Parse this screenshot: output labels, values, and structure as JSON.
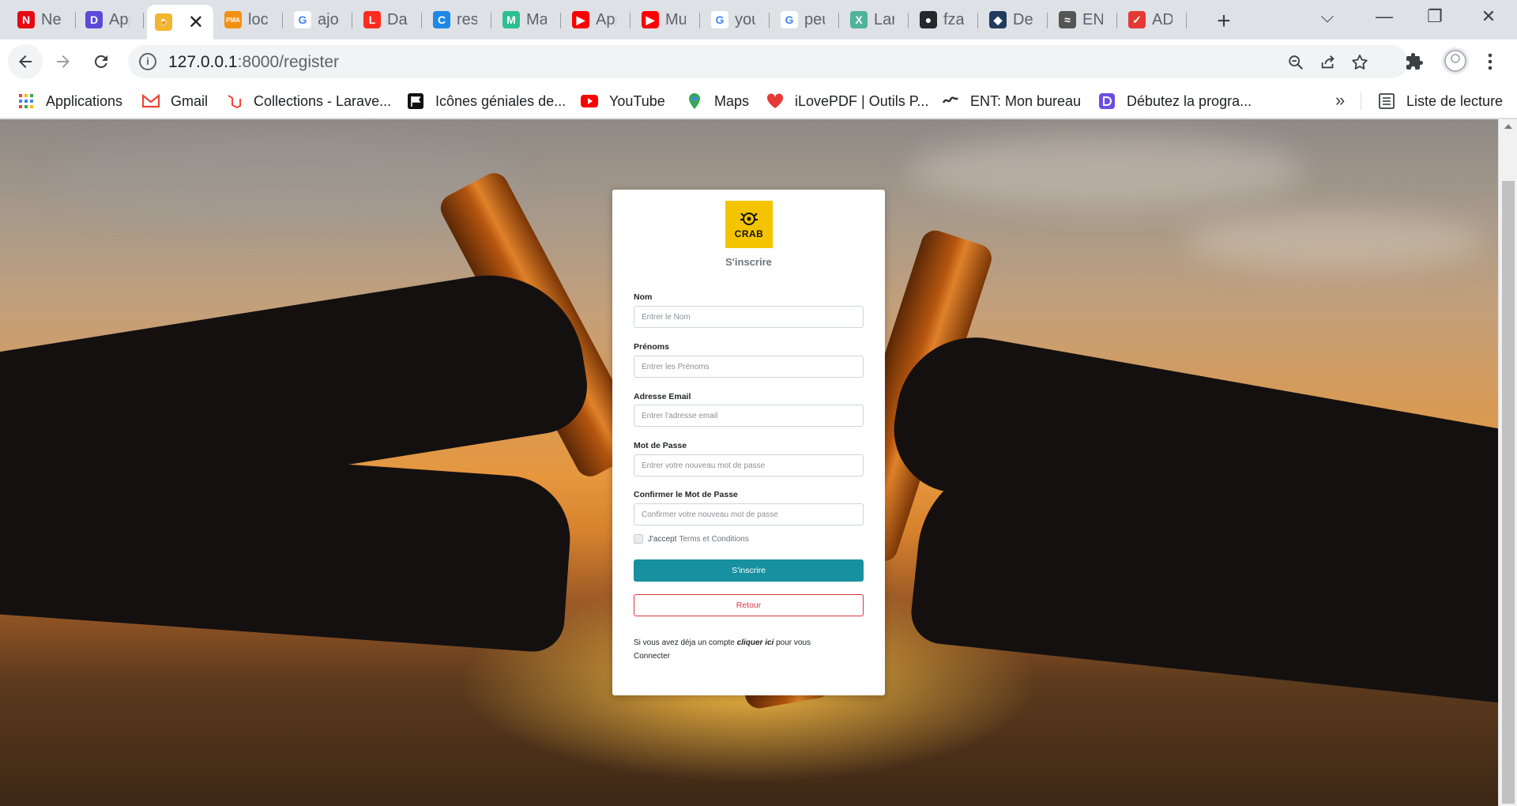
{
  "browser": {
    "tabs": [
      {
        "label": "Netflix",
        "icon": "netflix-icon",
        "color": "#e50914",
        "glyph": "N"
      },
      {
        "label": "Applications",
        "icon": "d-app-icon",
        "color": "#5b4ad9",
        "glyph": "D"
      },
      {
        "label": "",
        "icon": "beer-icon",
        "active": true,
        "color": "#f3b633",
        "glyph": "🍺"
      },
      {
        "label": "localhost",
        "icon": "phpmyadmin-icon",
        "color": "#f29111",
        "glyph": "PMA"
      },
      {
        "label": "ajouter",
        "icon": "google-icon",
        "color": "#ffffff",
        "glyph": "G"
      },
      {
        "label": "Database",
        "icon": "laravel-icon",
        "color": "#ff2d20",
        "glyph": "L"
      },
      {
        "label": "resources",
        "icon": "c-icon",
        "color": "#1e88e5",
        "glyph": "C"
      },
      {
        "label": "Material",
        "icon": "m-icon",
        "color": "#2ebf91",
        "glyph": "M"
      },
      {
        "label": "App",
        "icon": "youtube-icon",
        "color": "#ff0000",
        "glyph": "▶"
      },
      {
        "label": "Music",
        "icon": "youtube-icon",
        "color": "#ff0000",
        "glyph": "▶"
      },
      {
        "label": "youtube",
        "icon": "google-icon",
        "color": "#ffffff",
        "glyph": "G"
      },
      {
        "label": "peut",
        "icon": "google-icon",
        "color": "#ffffff",
        "glyph": "G"
      },
      {
        "label": "Laravel",
        "icon": "laravel-icon",
        "color": "#4fb39a",
        "glyph": "X"
      },
      {
        "label": "fzar",
        "icon": "github-icon",
        "color": "#24292e",
        "glyph": "●"
      },
      {
        "label": "Deezer",
        "icon": "deezer-icon",
        "color": "#233b5d",
        "glyph": "◆"
      },
      {
        "label": "ENT",
        "icon": "ent-icon",
        "color": "#555555",
        "glyph": "≈"
      },
      {
        "label": "ADE",
        "icon": "ade-icon",
        "color": "#e53935",
        "glyph": "✓"
      }
    ],
    "new_tab": "+",
    "address": {
      "host": "127.0.0.1",
      "path": ":8000/register",
      "info_glyph": "i"
    },
    "bookmarks": [
      {
        "label": "Applications",
        "icon": "apps-grid-icon"
      },
      {
        "label": "Gmail",
        "icon": "gmail-icon"
      },
      {
        "label": "Collections - Larave...",
        "icon": "laravel-icon"
      },
      {
        "label": "Icônes géniales de...",
        "icon": "fontawesome-flag-icon"
      },
      {
        "label": "YouTube",
        "icon": "youtube-icon"
      },
      {
        "label": "Maps",
        "icon": "maps-pin-icon"
      },
      {
        "label": "iLovePDF | Outils P...",
        "icon": "ilovepdf-heart-icon"
      },
      {
        "label": "ENT: Mon bureau",
        "icon": "ent-icon"
      },
      {
        "label": "Débutez la progra...",
        "icon": "d-app-icon"
      }
    ],
    "overflow": "»",
    "reading_list": "Liste de lecture"
  },
  "register": {
    "logo_text": "CRAB",
    "title": "S'inscrire",
    "fields": {
      "nom": {
        "label": "Nom",
        "placeholder": "Entrer le Nom"
      },
      "prenoms": {
        "label": "Prénoms",
        "placeholder": "Entrer les Prénoms"
      },
      "email": {
        "label": "Adresse Email",
        "placeholder": "Entrer l'adresse email"
      },
      "password": {
        "label": "Mot de Passe",
        "placeholder": "Entrer votre nouveau mot de passe"
      },
      "confirm": {
        "label": "Confirmer le Mot de Passe",
        "placeholder": "Confirmer votre nouveau mot de passe"
      }
    },
    "terms_prefix": "J'accept",
    "terms_link": "Terms et Conditions",
    "submit_label": "S'inscrire",
    "back_label": "Retour",
    "login_note_prefix": "Si vous avez déja un compte",
    "login_link": "cliquer ici",
    "login_note_suffix": "pour vous Connecter"
  },
  "colors": {
    "primary_button": "#17909f",
    "back_button": "#dc3545",
    "logo_bg": "#f5c400"
  }
}
